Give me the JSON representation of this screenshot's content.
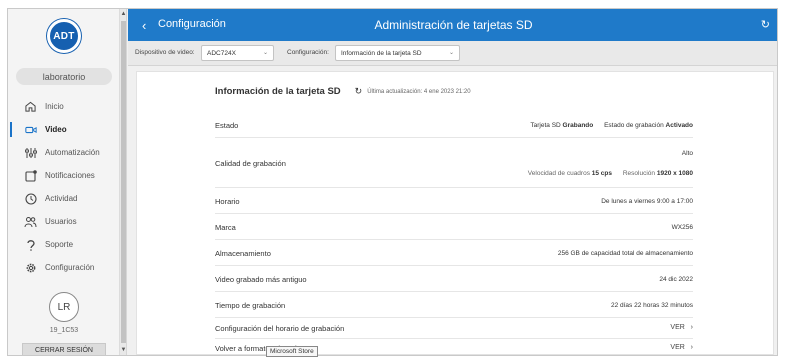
{
  "sidebar": {
    "logo_text": "ADT",
    "location": "laboratorio",
    "items": [
      {
        "label": "Inicio",
        "icon": "home-icon"
      },
      {
        "label": "Video",
        "icon": "video-camera-icon",
        "active": true
      },
      {
        "label": "Automatización",
        "icon": "sliders-icon"
      },
      {
        "label": "Notificaciones",
        "icon": "notification-icon"
      },
      {
        "label": "Actividad",
        "icon": "clock-icon"
      },
      {
        "label": "Usuarios",
        "icon": "users-icon"
      },
      {
        "label": "Soporte",
        "icon": "support-icon"
      },
      {
        "label": "Configuración",
        "icon": "gear-icon"
      }
    ],
    "avatar_initials": "LR",
    "user_id": "19_1C53",
    "logout_label": "CERRAR SESIÓN"
  },
  "header": {
    "back_label": "Configuración",
    "title": "Administración de tarjetas SD"
  },
  "toolbar": {
    "device_label": "Dispositivo de video:",
    "device_value": "ADC724X",
    "config_label": "Configuración:",
    "config_value": "Información de la tarjeta SD"
  },
  "section": {
    "title": "Información de la tarjeta SD",
    "last_update": "Última actualización: 4 ene 2023 21:20"
  },
  "rows": {
    "estado": {
      "label": "Estado",
      "card_label": "Tarjeta SD",
      "card_value": "Grabando",
      "rec_label": "Estado de grabación",
      "rec_value": "Activado"
    },
    "calidad": {
      "label": "Calidad de grabación",
      "level": "Alto",
      "fps_label": "Velocidad de cuadros",
      "fps_value": "15 cps",
      "res_label": "Resolución",
      "res_value": "1920 x 1080"
    },
    "horario": {
      "label": "Horario",
      "value": "De lunes a viernes 9:00 a 17:00"
    },
    "marca": {
      "label": "Marca",
      "value": "WX256"
    },
    "almacenamiento": {
      "label": "Almacenamiento",
      "value": "256 GB de capacidad total de almacenamiento"
    },
    "antiguo": {
      "label": "Video grabado más antiguo",
      "value": "24 dic 2022"
    },
    "tiempo": {
      "label": "Tiempo de grabación",
      "value": "22 días 22 horas 32 minutos"
    },
    "config_horario": {
      "label": "Configuración del horario de grabación",
      "action": "VER"
    },
    "formatear": {
      "label": "Volver a formatear la tarjeta",
      "action": "VER"
    }
  },
  "tooltip": "Microsoft Store",
  "colors": {
    "accent": "#1f7ac9",
    "logo": "#1660b0"
  }
}
